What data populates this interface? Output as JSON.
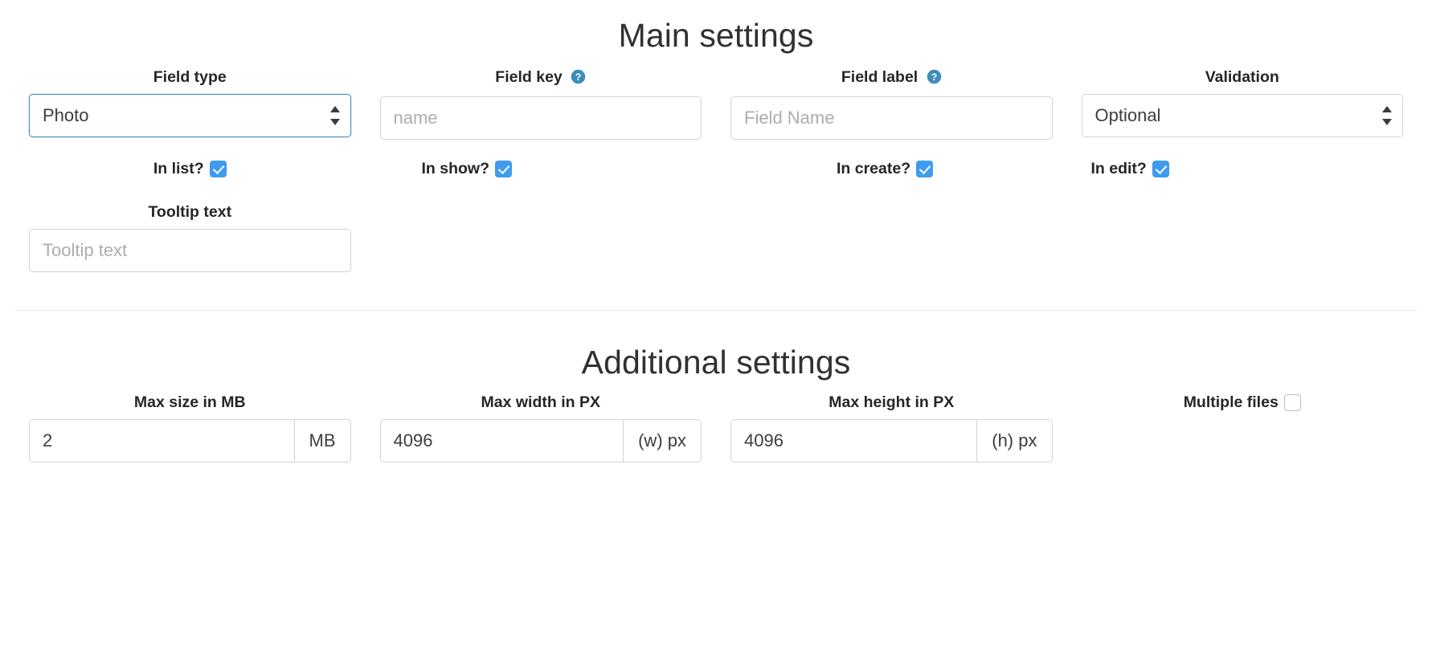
{
  "main_section": {
    "title": "Main settings",
    "fields": [
      {
        "label": "Field type",
        "has_help": false,
        "control": "select",
        "value": "Photo",
        "focused": true
      },
      {
        "label": "Field key",
        "has_help": true,
        "help_icon": "question-circle-icon",
        "control": "text",
        "value": "",
        "placeholder": "name",
        "focused": false
      },
      {
        "label": "Field label",
        "has_help": true,
        "help_icon": "question-circle-icon",
        "control": "text",
        "value": "",
        "placeholder": "Field Name",
        "focused": false
      },
      {
        "label": "Validation",
        "has_help": false,
        "control": "select",
        "value": "Optional",
        "focused": false
      }
    ],
    "checkboxes": [
      {
        "label": "In list?",
        "checked": true
      },
      {
        "label": "In show?",
        "checked": true
      },
      {
        "label": "In create?",
        "checked": true
      },
      {
        "label": "In edit?",
        "checked": true
      }
    ],
    "tooltip_field": {
      "label": "Tooltip text",
      "value": "",
      "placeholder": "Tooltip text"
    }
  },
  "additional_section": {
    "title": "Additional settings",
    "fields": [
      {
        "label": "Max size in MB",
        "value": "2",
        "suffix": "MB"
      },
      {
        "label": "Max width in PX",
        "value": "4096",
        "suffix": "(w) px"
      },
      {
        "label": "Max height in PX",
        "value": "4096",
        "suffix": "(h) px"
      }
    ],
    "multiple_files": {
      "label": "Multiple files",
      "checked": false
    }
  },
  "colors": {
    "accent_blue": "#3e9bf0",
    "focus_border": "#3d8dba",
    "help_icon": "#3d8dba",
    "border": "#ced4da",
    "text": "#2f2f35",
    "placeholder": "#a9adb3",
    "divider": "#e6e7e9"
  }
}
